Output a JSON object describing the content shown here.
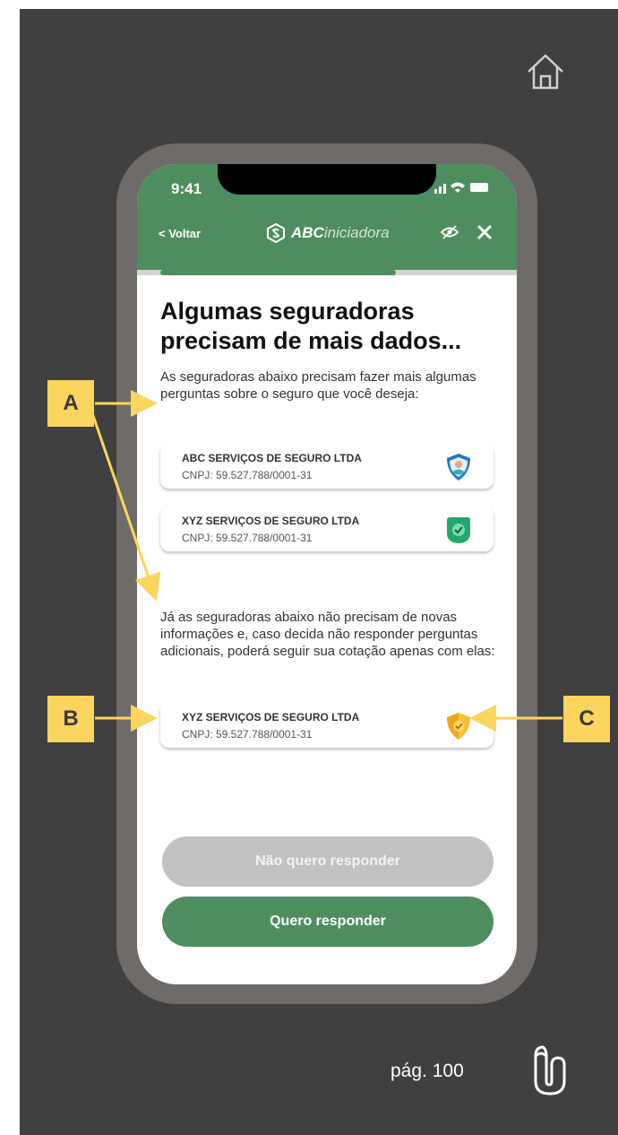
{
  "status_bar": {
    "time": "9:41"
  },
  "header": {
    "back_label": "< Voltar",
    "brand_bold": "ABC",
    "brand_light": "iniciadora"
  },
  "progress": {
    "fraction": 0.62
  },
  "content": {
    "title": "Algumas seguradoras precisam de mais dados...",
    "paragraph_1": "As seguradoras abaixo precisam fazer mais algumas perguntas sobre o seguro que você deseja:",
    "paragraph_2": "Já as seguradoras abaixo não precisam de novas informações e, caso decida não responder perguntas adicionais, poderá seguir sua cotação apenas com elas:",
    "cards": [
      {
        "name": "ABC SERVIÇOS DE SEGURO LTDA",
        "cnpj": "CNPJ: 59.527.788/0001-31",
        "icon": "shield-blue-icon"
      },
      {
        "name": "XYZ SERVIÇOS DE SEGURO LTDA",
        "cnpj": "CNPJ: 59.527.788/0001-31",
        "icon": "shield-green-icon"
      },
      {
        "name": "XYZ SERVIÇOS DE SEGURO LTDA",
        "cnpj": "CNPJ: 59.527.788/0001-31",
        "icon": "shield-yellow-icon"
      }
    ]
  },
  "buttons": {
    "decline_label": "Não quero responder",
    "accept_label": "Quero responder"
  },
  "annotations": {
    "marker_a": "A",
    "marker_b": "B",
    "marker_c": "C"
  },
  "footer": {
    "page_label": "pág. 100"
  },
  "colors": {
    "brand_green": "#4e8e5e",
    "marker_yellow": "#fbd55e",
    "background_dark": "#404040",
    "disabled_gray": "#c2c2c2"
  }
}
